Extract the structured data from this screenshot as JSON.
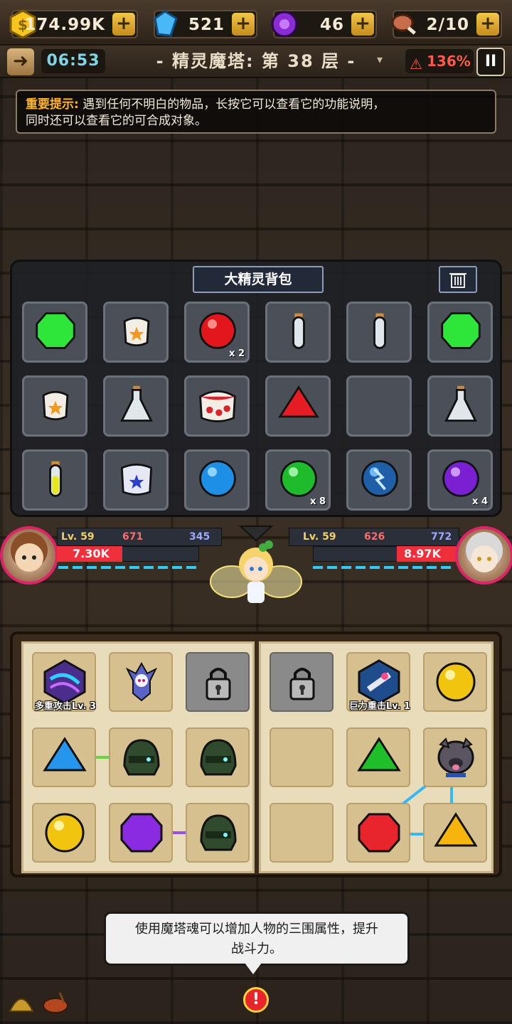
{
  "resources": {
    "gold": "174.99K",
    "diamond": "521",
    "soul": "46",
    "meat": "2/10",
    "plus_label": "+"
  },
  "header": {
    "exit_icon": "exit-arrow-icon",
    "timer": "06:53",
    "floor_title": "- 精灵魔塔: 第 38 层 -",
    "floor_dropdown": "▾",
    "danger_icon": "warning-triangle-icon",
    "danger_percent": "136%",
    "pause_label": "II"
  },
  "tip": {
    "label": "重要提示:",
    "text_line1": "遇到任何不明白的物品，长按它可以查看它的功能说明，",
    "text_line2": "同时还可以查看它的可合成对象。"
  },
  "backpack": {
    "title": "大精灵背包",
    "trash_icon": "trash-icon",
    "slots": [
      {
        "item": "green-gem",
        "count": ""
      },
      {
        "item": "small-star-bag",
        "count": ""
      },
      {
        "item": "red-orb",
        "count": "x 2"
      },
      {
        "item": "empty-test-tube",
        "count": ""
      },
      {
        "item": "empty-test-tube",
        "count": ""
      },
      {
        "item": "green-gem",
        "count": ""
      },
      {
        "item": "small-star-bag",
        "count": ""
      },
      {
        "item": "empty-flask",
        "count": ""
      },
      {
        "item": "big-star-bag",
        "count": ""
      },
      {
        "item": "red-pyramid",
        "count": ""
      },
      {
        "item": "empty",
        "count": ""
      },
      {
        "item": "empty-flask",
        "count": ""
      },
      {
        "item": "yellow-test-tube",
        "count": ""
      },
      {
        "item": "blue-star-bag",
        "count": ""
      },
      {
        "item": "blue-orb",
        "count": ""
      },
      {
        "item": "green-orb",
        "count": "x 8"
      },
      {
        "item": "lightning-orb",
        "count": ""
      },
      {
        "item": "purple-orb",
        "count": "x 4"
      }
    ]
  },
  "player": {
    "level": "Lv. 59",
    "attack": "671",
    "defense": "345",
    "hp": "7.30K"
  },
  "enemy": {
    "level": "Lv. 59",
    "attack": "626",
    "defense": "772",
    "hp": "8.97K"
  },
  "book": {
    "left_cells": [
      {
        "item": "multi-attack-crystal",
        "label": "多重攻击Lv. 3"
      },
      {
        "item": "spirit-figure",
        "label": ""
      },
      {
        "item": "lock",
        "label": ""
      },
      {
        "item": "blue-pyramid",
        "label": ""
      },
      {
        "item": "green-helmet",
        "label": ""
      },
      {
        "item": "green-helmet",
        "label": ""
      },
      {
        "item": "yellow-orb",
        "label": ""
      },
      {
        "item": "purple-gem",
        "label": ""
      },
      {
        "item": "green-helmet",
        "label": ""
      }
    ],
    "right_cells": [
      {
        "item": "lock",
        "label": ""
      },
      {
        "item": "power-strike-crystal",
        "label": "巨力重击Lv. 1"
      },
      {
        "item": "yellow-orb",
        "label": ""
      },
      {
        "item": "empty",
        "label": ""
      },
      {
        "item": "green-pyramid",
        "label": ""
      },
      {
        "item": "bulldog",
        "label": ""
      },
      {
        "item": "empty",
        "label": ""
      },
      {
        "item": "red-gem",
        "label": ""
      },
      {
        "item": "yellow-pyramid",
        "label": ""
      }
    ]
  },
  "hint_bubble": {
    "line1": "使用魔塔魂可以增加人物的三围属性，提升",
    "line2": "战斗力。"
  },
  "bottom": {
    "alert_label": "!"
  },
  "colors": {
    "gold_accent": "#f3c64a",
    "hp_red": "#ef2f3b",
    "danger_red": "#ff5a4a",
    "timer_cyan": "#7fd4e6"
  }
}
